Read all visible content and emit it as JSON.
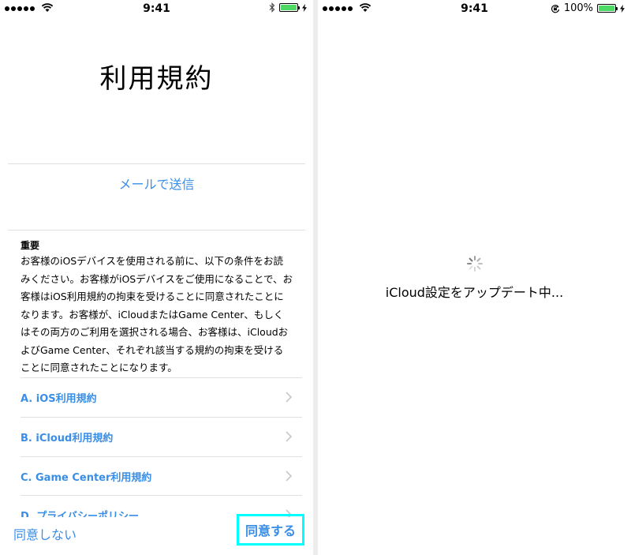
{
  "left": {
    "status": {
      "time": "9:41"
    },
    "title": "利用規約",
    "mail_link": "メールで送信",
    "terms": {
      "heading": "重要",
      "body": "お客様のiOSデバイスを使用される前に、以下の条件をお読みください。お客様がiOSデバイスをご使用になることで、お客様はiOS利用規約の拘束を受けることに同意されたことになります。お客様が、iCloudまたはGame Center、もしくはその両方のご利用を選択される場合、お客様は、iCloudおよびGame Center、それぞれ該当する規約の拘束を受けることに同意されたことになります。"
    },
    "links": [
      {
        "label": "A. iOS利用規約"
      },
      {
        "label": "B. iCloud利用規約"
      },
      {
        "label": "C. Game Center利用規約"
      },
      {
        "label": "D. プライバシーポリシー"
      }
    ],
    "bottom": {
      "disagree": "同意しない",
      "agree": "同意する"
    }
  },
  "right": {
    "status": {
      "time": "9:41",
      "battery_pct": "100%"
    },
    "updating": "iCloud設定をアップデート中..."
  },
  "colors": {
    "link": "#3a8ee6",
    "battery": "#4cd964",
    "highlight": "#00ffff"
  }
}
